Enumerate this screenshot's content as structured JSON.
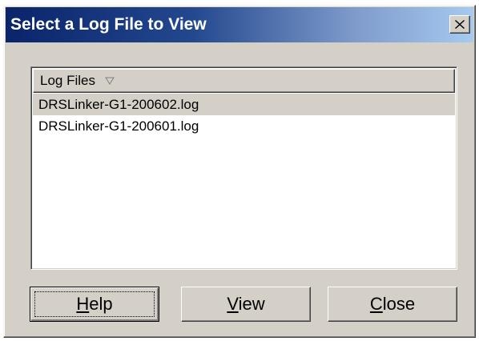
{
  "window": {
    "title": "Select a Log File to View",
    "close_icon": "close-icon"
  },
  "list": {
    "column_header": "Log Files",
    "sort_icon": "sort-down-triangle-icon",
    "items": [
      {
        "label": "DRSLinker-G1-200602.log",
        "selected": true
      },
      {
        "label": "DRSLinker-G1-200601.log",
        "selected": false
      }
    ]
  },
  "buttons": {
    "help": {
      "mnemonic": "H",
      "rest": "elp",
      "is_default": true
    },
    "view": {
      "mnemonic": "V",
      "rest": "iew"
    },
    "close": {
      "mnemonic": "C",
      "rest": "lose"
    }
  },
  "colors": {
    "face": "#d4d0c8",
    "title_start": "#0a246a",
    "title_end": "#a6caf0",
    "selection": "#d4d0c8"
  }
}
